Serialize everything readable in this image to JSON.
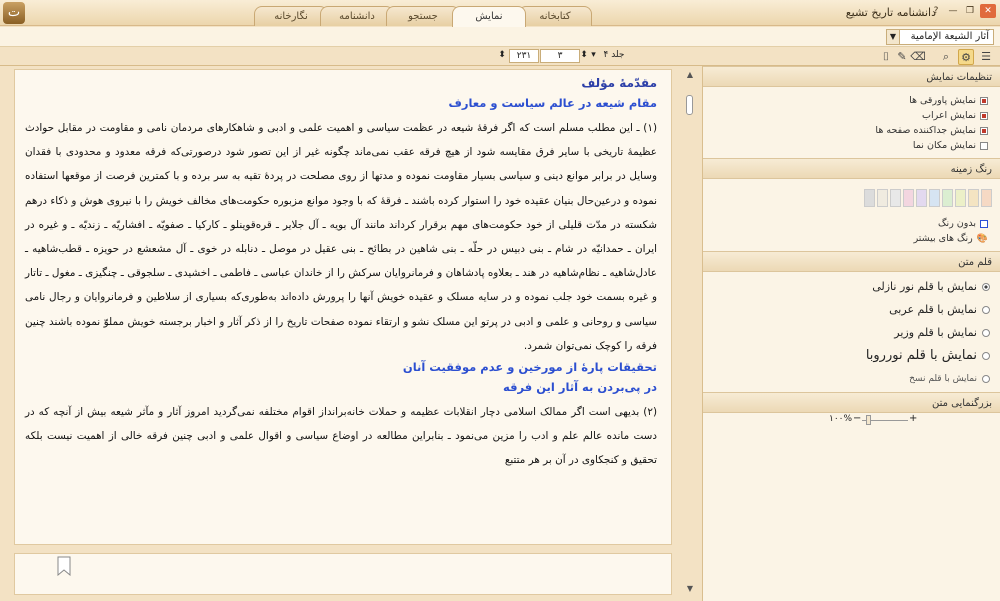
{
  "window": {
    "title": "دانشنامه تاریخ تشیع",
    "logo": "ت",
    "help": "?",
    "minimize": "—",
    "restore": "❐",
    "close": "✕"
  },
  "tabs": [
    "نگارخانه",
    "دانشنامه",
    "جستجو",
    "نمایش",
    "کتابخانه"
  ],
  "book_select": "آثار الشيعة الإمامية",
  "nav": {
    "volume_label": "جلد ۴",
    "page": "۳",
    "page_total": "۲۳۱"
  },
  "content": {
    "title": "مقدّمهٔ مؤلف",
    "heading1": "مقام شیعه در عالم سیاست و معارف",
    "para1": "(۱) ـ این مطلب مسلم است که اگر فرقهٔ شیعه در عظمت سیاسی و اهمیت علمی و ادبی و شاهکارهای مردمان نامی و مقاومت در مقابل حوادث عظیمهٔ تاریخی با سایر فرق مقایسه شود از هیچ فرقه عقب نمی‌ماند چگونه غیر از این تصور شود درصورتی‌که فرقه معدود و محدودی با فقدان وسایل در برابر موانع دینی و سیاسی بسیار مقاومت نموده و مدتها از روی مصلحت در پردهٔ تقیه به سر برده و با کمترین فرصت از موقعها استفاده نموده و درعین‌حال بنیان عقیده خود را استوار کرده باشند ـ فرقهٔ که با وجود موانع مزبوره حکومت‌های مخالف خویش را با نیروی هوش و ذکاء درهم شکسته در مدّت قلیلی از خود حکومت‌های مهم برقرار کرداند مانند آل بویه ـ آل جلایر ـ قره‌قوینلو ـ کارکیا ـ صفویّه ـ افشاریّه ـ زندیّه ـ و غیره در ایران ـ حمدانیّه در شام ـ بنی دبیس در حلّه ـ بنی شاهین در بطائح ـ بنی عقیل در موصل ـ دنابله در خوی ـ آل مشعشع در حویزه ـ قطب‌شاهیه ـ عادل‌شاهیه ـ نظام‌شاهیه در هند ـ بعلاوه پادشاهان و فرمانروایان سرکش را از خاندان عباسی ـ فاطمی ـ اخشیدی ـ سلجوقی ـ چنگیزی ـ مغول ـ تاتار و غیره بسمت خود جلب نموده و در سایه مسلک و عقیده خویش آنها را پرورش داده‌اند به‌طوری‌که بسیاری از سلاطین و فرمانروایان و رجال نامی سیاسی و روحانی و علمی و ادبی در پرتو این مسلک نشو و ارتقاء نموده صفحات تاریخ را از ذکر آثار و اخبار برجسته خویش مملوّ نموده باشند چنین فرقه را کوچک نمی‌توان شمرد.",
    "heading2": "تحقیقات پارهٔ از مورخین و عدم موفقیت آنان",
    "heading3": "در پی‌بردن به آثار این فرقه",
    "para2": "(۲) بدیهی است اگر ممالک اسلامی دچار انقلابات عظیمه و حملات خانه‌برانداز اقوام مختلفه نمی‌گردید امروز آثار و مآثر شیعه بیش از آنچه که در دست مانده عالم علم و ادب را مزین می‌نمود ـ بنابراین مطالعه در اوضاع سیاسی و اقوال علمی و ادبی چنین فرقه خالی از اهمیت نیست بلکه تحقیق و کنجکاوی در آن بر هر متتبع"
  },
  "sidebar": {
    "display_settings": {
      "title": "تنظیمات نمایش",
      "options": [
        {
          "label": "نمایش پاورقی ها",
          "checked": true
        },
        {
          "label": "نمایش اعراب",
          "checked": true
        },
        {
          "label": "نمایش جداکننده صفحه ها",
          "checked": true
        },
        {
          "label": "نمایش مکان نما",
          "checked": false
        }
      ]
    },
    "background": {
      "title": "رنگ زمینه",
      "colors": [
        "#f6d9c4",
        "#f4e4c2",
        "#ecf0c8",
        "#dbeed1",
        "#d6e4f2",
        "#e3d9ef",
        "#f3d6e0",
        "#e8e8e8",
        "#f0ebe0",
        "#dcdcdc"
      ],
      "no_color": "بدون رنگ",
      "more_colors": "رنگ های بیشتر"
    },
    "font": {
      "title": "قلم متن",
      "options": [
        {
          "label": "نمایش با قلم نور نازلی",
          "selected": true
        },
        {
          "label": "نمایش با قلم عربی",
          "selected": false
        },
        {
          "label": "نمایش با قلم وزیر",
          "selected": false
        },
        {
          "label": "نمایش با قلم نورروبا",
          "selected": false
        },
        {
          "label": "نمایش با قلم نسخ",
          "selected": false
        }
      ]
    },
    "zoom": {
      "title": "بزرگنمایی متن",
      "value": "۱۰۰%",
      "plus": "+",
      "minus": "−"
    }
  }
}
